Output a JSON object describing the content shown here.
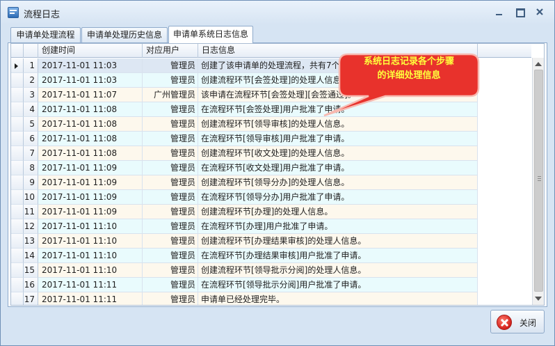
{
  "window": {
    "title": "流程日志"
  },
  "tabs": [
    {
      "label": "申请单处理流程"
    },
    {
      "label": "申请单处理历史信息"
    },
    {
      "label": "申请单系统日志信息"
    }
  ],
  "grid": {
    "columns": {
      "time": "创建时间",
      "user": "对应用户",
      "info": "日志信息"
    },
    "selected_row": 1,
    "rows": [
      {
        "num": "1",
        "time": "2017-11-01 11:03",
        "user": "管理员",
        "info": "创建了该申请单的处理流程，共有7个流程环节。"
      },
      {
        "num": "2",
        "time": "2017-11-01 11:03",
        "user": "管理员",
        "info": "创建流程环节[会签处理]的处理人信息。"
      },
      {
        "num": "3",
        "time": "2017-11-01 11:07",
        "user": "广州管理员",
        "info": "该申请在流程环节[会签处理][会签通过]。"
      },
      {
        "num": "4",
        "time": "2017-11-01 11:08",
        "user": "管理员",
        "info": "在流程环节[会签处理]用户批准了申请。"
      },
      {
        "num": "5",
        "time": "2017-11-01 11:08",
        "user": "管理员",
        "info": "创建流程环节[领导审核]的处理人信息。"
      },
      {
        "num": "6",
        "time": "2017-11-01 11:08",
        "user": "管理员",
        "info": "在流程环节[领导审核]用户批准了申请。"
      },
      {
        "num": "7",
        "time": "2017-11-01 11:08",
        "user": "管理员",
        "info": "创建流程环节[收文处理]的处理人信息。"
      },
      {
        "num": "8",
        "time": "2017-11-01 11:09",
        "user": "管理员",
        "info": "在流程环节[收文处理]用户批准了申请。"
      },
      {
        "num": "9",
        "time": "2017-11-01 11:09",
        "user": "管理员",
        "info": "创建流程环节[领导分办]的处理人信息。"
      },
      {
        "num": "10",
        "time": "2017-11-01 11:09",
        "user": "管理员",
        "info": "在流程环节[领导分办]用户批准了申请。"
      },
      {
        "num": "11",
        "time": "2017-11-01 11:09",
        "user": "管理员",
        "info": "创建流程环节[办理]的处理人信息。"
      },
      {
        "num": "12",
        "time": "2017-11-01 11:10",
        "user": "管理员",
        "info": "在流程环节[办理]用户批准了申请。"
      },
      {
        "num": "13",
        "time": "2017-11-01 11:10",
        "user": "管理员",
        "info": "创建流程环节[办理结果审核]的处理人信息。"
      },
      {
        "num": "14",
        "time": "2017-11-01 11:10",
        "user": "管理员",
        "info": "在流程环节[办理结果审核]用户批准了申请。"
      },
      {
        "num": "15",
        "time": "2017-11-01 11:10",
        "user": "管理员",
        "info": "创建流程环节[领导批示分阅]的处理人信息。"
      },
      {
        "num": "16",
        "time": "2017-11-01 11:11",
        "user": "管理员",
        "info": "在流程环节[领导批示分阅]用户批准了申请。"
      },
      {
        "num": "17",
        "time": "2017-11-01 11:11",
        "user": "管理员",
        "info": "申请单已经处理完毕。"
      }
    ]
  },
  "callout": {
    "line1": "系统日志记录各个步骤",
    "line2": "的详细处理信息"
  },
  "buttons": {
    "close_label": "关闭"
  },
  "colors": {
    "callout_fill": "#e8322c",
    "callout_text": "#ffff3c",
    "odd_row": "#fdf8ed",
    "even_row": "#e9fbfd"
  }
}
